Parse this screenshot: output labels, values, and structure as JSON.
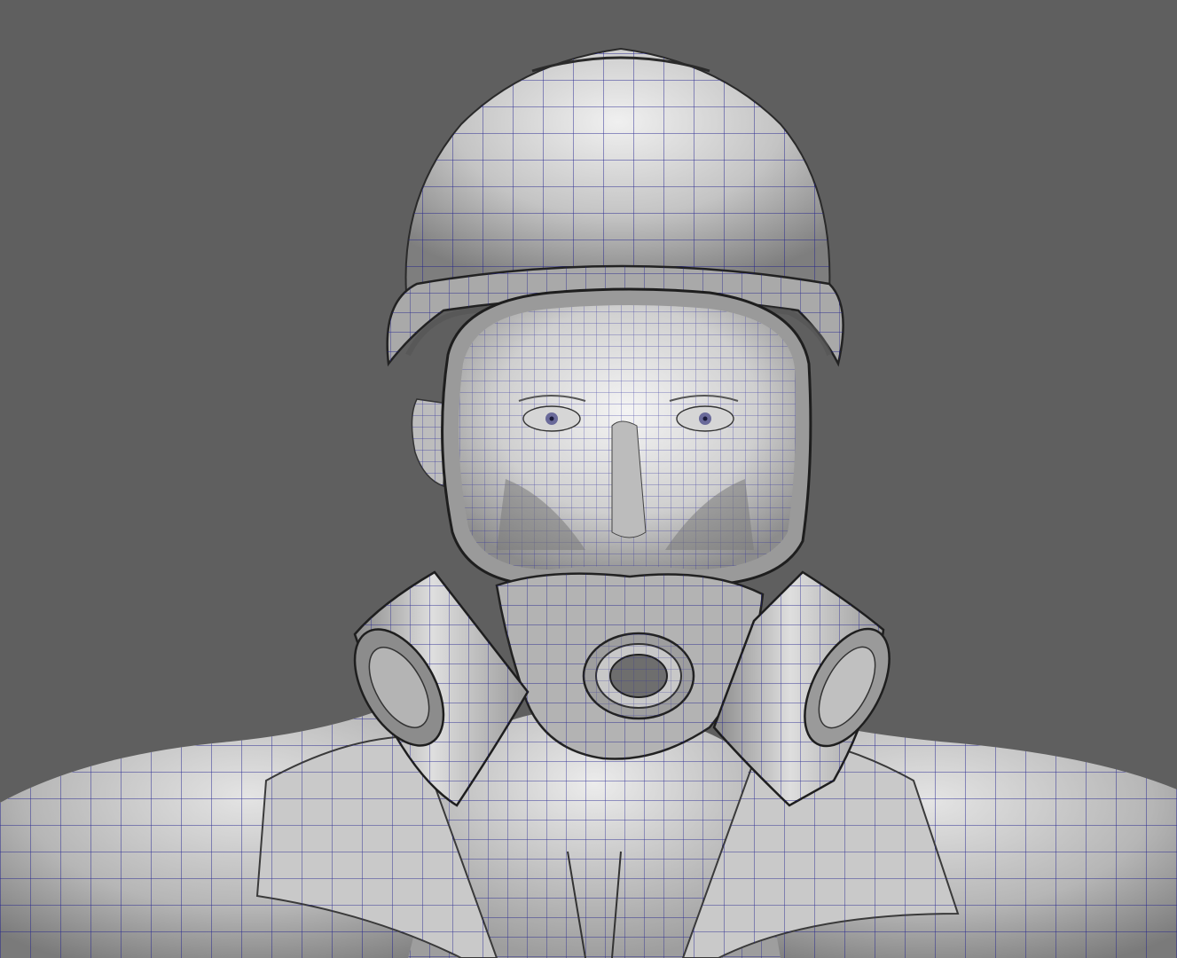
{
  "viewport": {
    "background_color": "#5f5f5f",
    "wire_color": "#1c1c8c",
    "surface_light": "#e6e6e6",
    "surface_mid": "#bdbdbd",
    "surface_dark": "#7c7c7c",
    "subject": "3d-wireframe-model-worker-with-hard-hat-and-gas-mask"
  }
}
